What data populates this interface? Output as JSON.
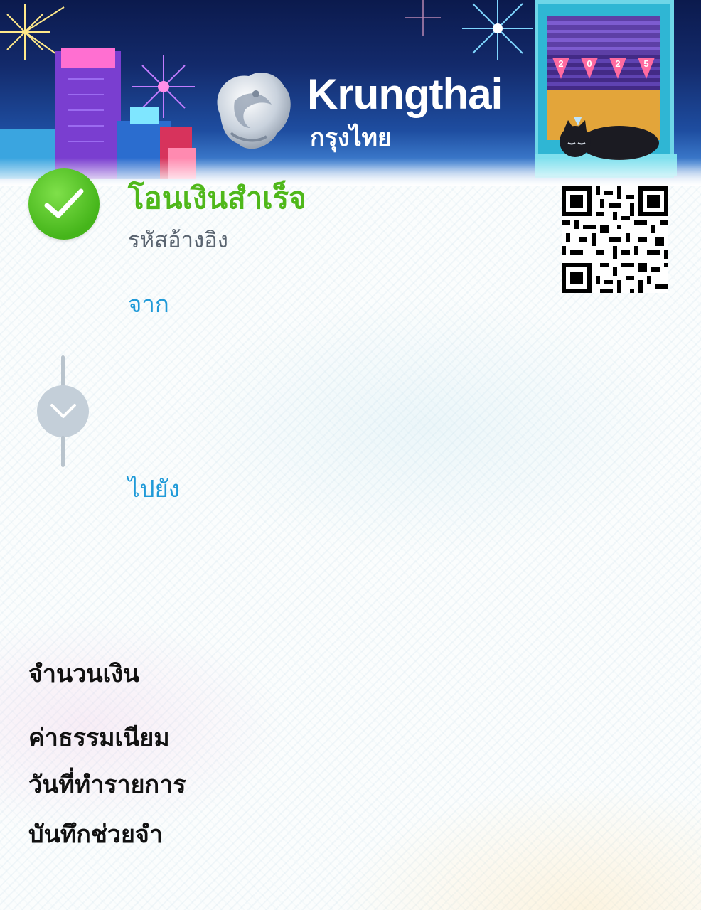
{
  "header": {
    "brand_en": "Krungthai",
    "brand_th": "กรุงไทย",
    "year_flags": [
      "2",
      "0",
      "2",
      "5"
    ]
  },
  "receipt": {
    "status_title": "โอนเงินสำเร็จ",
    "reference_label": "รหัสอ้างอิง",
    "from_label": "จาก",
    "to_label": "ไปยัง"
  },
  "details": {
    "amount_label": "จำนวนเงิน",
    "fee_label": "ค่าธรรมเนียม",
    "date_label": "วันที่ทำรายการ",
    "memo_label": "บันทึกช่วยจำ"
  },
  "colors": {
    "success_green": "#4fb81a",
    "link_blue": "#1f9ad8",
    "banner_dark": "#0b1a4d"
  },
  "icons": {
    "status": "check-circle-icon",
    "flow": "chevron-down-icon",
    "qr": "qr-code-icon"
  }
}
